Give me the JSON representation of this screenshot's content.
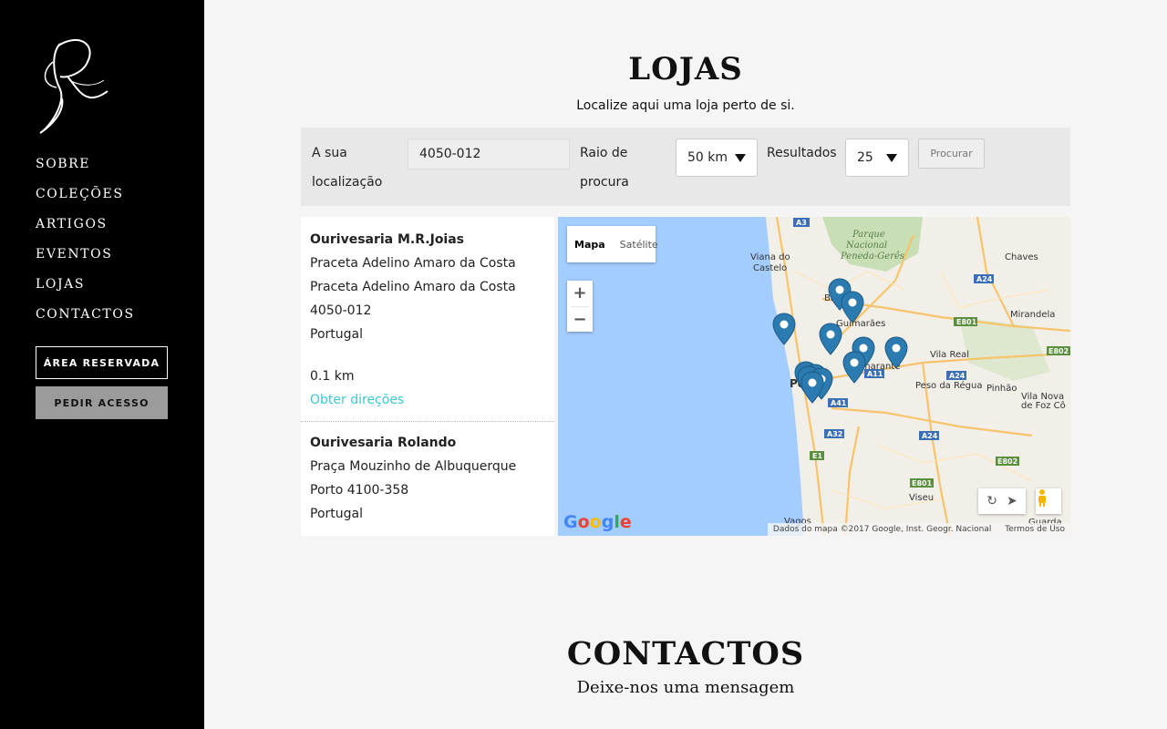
{
  "sidebar": {
    "nav": [
      "SOBRE",
      "COLEÇÕES",
      "ARTIGOS",
      "EVENTOS",
      "LOJAS",
      "CONTACTOS"
    ],
    "reserved_button": "ÁREA RESERVADA",
    "access_button": "PEDIR ACESSO"
  },
  "lojas": {
    "title": "LOJAS",
    "subtitle": "Localize aqui uma loja perto de si."
  },
  "search": {
    "location_label_1": "A sua",
    "location_label_2": "localização",
    "location_value": "4050-012",
    "radius_label_1": "Raio de",
    "radius_label_2": "procura",
    "radius_value": "50 km",
    "results_label": "Resultados",
    "results_value": "25",
    "submit_label": "Procurar"
  },
  "stores": [
    {
      "name": "Ourivesaria M.R.Joias",
      "lines": [
        "Praceta Adelino Amaro da Costa",
        "Praceta Adelino Amaro da Costa",
        "4050-012",
        "Portugal"
      ],
      "distance": "0.1 km",
      "directions": "Obter direções"
    },
    {
      "name": "Ourivesaria Rolando",
      "lines": [
        "Praça Mouzinho de Albuquerque",
        "Porto 4100-358",
        "Portugal"
      ]
    }
  ],
  "map": {
    "tab_map": "Mapa",
    "tab_satellite": "Satélite",
    "zoom_in": "+",
    "zoom_out": "−",
    "logo": "Google",
    "attribution": "Dados do mapa ©2017 Google, Inst. Geogr. Nacional",
    "terms": "Termos de Uso",
    "labels": {
      "a3": "A3",
      "pn1": "Parque",
      "pn2": "Nacional",
      "pn3": "Peneda-Gerês",
      "viana1": "Viana do",
      "viana2": "Castelo",
      "chaves": "Chaves",
      "a24a": "A24",
      "braga": "Braga",
      "guimaraes": "Guimarães",
      "e801a": "E801",
      "mirandela": "Mirandela",
      "vilareal": "Vila Real",
      "e802a": "E802",
      "amarante": "Amarante",
      "a11": "A11",
      "a24b": "A24",
      "porto": "Porto",
      "pesoregua": "Peso da Régua",
      "pinhao": "Pinhão",
      "vilanova1": "Vila Nova",
      "vilanova2": "de Foz Cô",
      "a41": "A41",
      "a32": "A32",
      "a24c": "A24",
      "e1": "E1",
      "e802b": "E802",
      "e801b": "E801",
      "viseu": "Viseu",
      "vagos": "Vagos",
      "guarda": "Guarda"
    },
    "marker_color": "#2b7bb0",
    "water_color": "#a3ccff"
  },
  "contactos": {
    "title": "CONTACTOS",
    "subtitle": "Deixe-nos uma mensagem"
  }
}
